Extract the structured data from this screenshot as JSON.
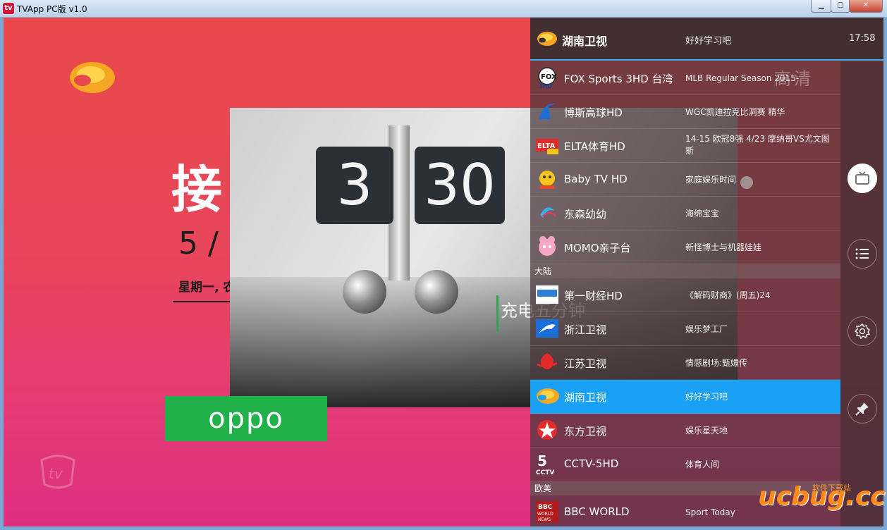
{
  "window": {
    "title": "TVApp PC版 v1.0",
    "app_icon": "tv",
    "controls": [
      "minimize",
      "maximize",
      "close"
    ]
  },
  "video": {
    "big_char": "接",
    "date_text": "5 /",
    "day_text": "星期一, 农",
    "ad_caption": "充电五分钟",
    "ad_flip_left": "3",
    "ad_flip_right": "30",
    "oppo_label": "oppo"
  },
  "now_playing": {
    "channel": "湖南卫视",
    "program": "好好学习吧",
    "clock": "17:58"
  },
  "overlay_hd": "高清",
  "channels_top": [
    {
      "name": "FOX Sports 3HD 台湾",
      "program": "MLB Regular Season 2015-",
      "logo": "fox-sports-logo"
    },
    {
      "name": "博斯高球HD",
      "program": "WGC凯迪拉克比洞赛 精华",
      "logo": "bos-golf-logo"
    },
    {
      "name": "ELTA体育HD",
      "program": "14-15 欧冠8强 4/23 摩纳哥VS尤文图斯",
      "logo": "elta-logo"
    },
    {
      "name": "Baby TV HD",
      "program": "家庭娱乐时间",
      "logo": "babytv-logo"
    },
    {
      "name": "东森幼幼",
      "program": "海绵宝宝",
      "logo": "ettv-kids-logo"
    },
    {
      "name": "MOMO亲子台",
      "program": "新怪博士与机器娃娃",
      "logo": "momo-logo"
    }
  ],
  "group_mainland": "大陆",
  "channels_mainland": [
    {
      "name": "第一财经HD",
      "program": "《解码财商》(周五)24",
      "logo": "yicai-logo"
    },
    {
      "name": "浙江卫视",
      "program": "娱乐梦工厂",
      "logo": "zhejiang-logo"
    },
    {
      "name": "江苏卫视",
      "program": "情感剧场:甄嬛传",
      "logo": "jiangsu-logo"
    },
    {
      "name": "湖南卫视",
      "program": "好好学习吧",
      "logo": "hunan-logo",
      "selected": true
    },
    {
      "name": "东方卫视",
      "program": "娱乐星天地",
      "logo": "dragon-tv-logo"
    },
    {
      "name": "CCTV-5HD",
      "program": "体育人间",
      "logo": "cctv5-logo"
    }
  ],
  "group_west": "欧美",
  "channels_west": [
    {
      "name": "BBC WORLD",
      "program": "Sport Today",
      "logo": "bbc-logo"
    }
  ],
  "watermark": {
    "brand": "ucbug",
    "tld": ".cc",
    "tagline": "软件下载站"
  },
  "colors": {
    "accent": "#19a1f5",
    "hunan_orange": "#f5a623",
    "oppo_green": "#21b14a"
  }
}
